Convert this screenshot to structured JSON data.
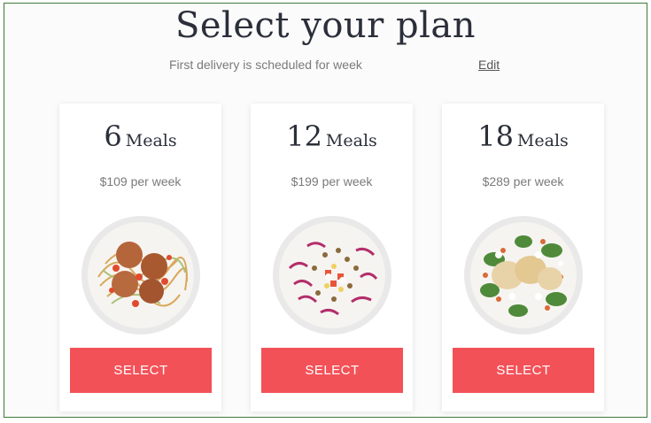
{
  "header": {
    "title": "Select your plan",
    "delivery_text": "First delivery is scheduled for week",
    "edit_label": "Edit"
  },
  "plans": [
    {
      "count": "6",
      "unit": "Meals",
      "price": "$109 per week",
      "button": "SELECT",
      "dish": "spaghetti-meatballs"
    },
    {
      "count": "12",
      "unit": "Meals",
      "price": "$199 per week",
      "button": "SELECT",
      "dish": "cabbage-quinoa-salad"
    },
    {
      "count": "18",
      "unit": "Meals",
      "price": "$289 per week",
      "button": "SELECT",
      "dish": "chicken-greens-bowl"
    }
  ],
  "colors": {
    "accent": "#f35158",
    "title": "#2b2f3a",
    "muted": "#7a7a7a",
    "frame": "#3f7a3a"
  }
}
